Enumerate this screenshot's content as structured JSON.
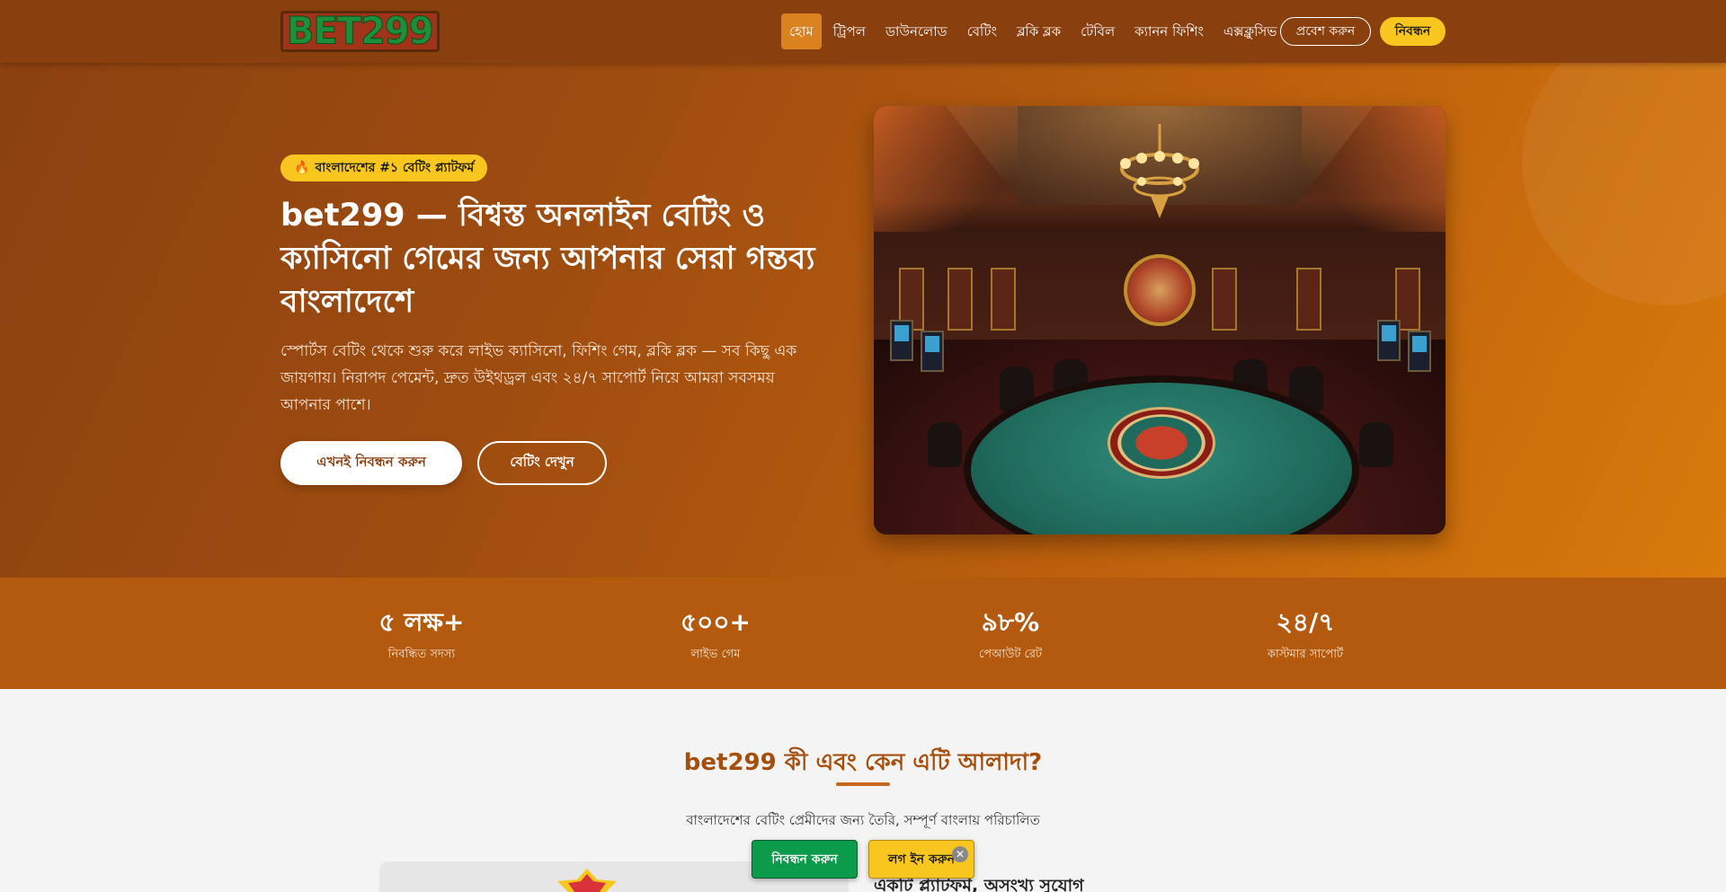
{
  "header": {
    "logo_text": "BET299",
    "nav": [
      {
        "label": "হোম",
        "active": true
      },
      {
        "label": "ট্রিপল"
      },
      {
        "label": "ডাউনলোড"
      },
      {
        "label": "বেটিং"
      },
      {
        "label": "ব্লকি ব্লক"
      },
      {
        "label": "টেবিল"
      },
      {
        "label": "ক্যানন ফিশিং"
      },
      {
        "label": "এক্সক্লুসিভ"
      }
    ],
    "login_label": "প্রবেশ করুন",
    "register_label": "নিবন্ধন"
  },
  "hero": {
    "badge_icon": "🔥",
    "badge_text": "বাংলাদেশের #১ বেটিং প্ল্যাটফর্ম",
    "title": "bet299 — বিশ্বস্ত অনলাইন বেটিং ও ক্যাসিনো গেমের জন্য আপনার সেরা গন্তব্য বাংলাদেশে",
    "description": "স্পোর্টস বেটিং থেকে শুরু করে লাইভ ক্যাসিনো, ফিশিং গেম, ব্লকি ব্লক — সব কিছু এক জায়গায়। নিরাপদ পেমেন্ট, দ্রুত উইথড্রল এবং ২৪/৭ সাপোর্ট নিয়ে আমরা সবসময় আপনার পাশে।",
    "primary_cta": "এখনই নিবন্ধন করুন",
    "secondary_cta": "বেটিং দেখুন"
  },
  "stats": [
    {
      "value": "৫ লক্ষ+",
      "label": "নিবন্ধিত সদস্য"
    },
    {
      "value": "৫০০+",
      "label": "লাইভ গেম"
    },
    {
      "value": "৯৮%",
      "label": "পেআউট রেট"
    },
    {
      "value": "২৪/৭",
      "label": "কাস্টমার সাপোর্ট"
    }
  ],
  "about": {
    "title": "bet299 কী এবং কেন এটি আলাদা?",
    "subtitle": "বাংলাদেশের বেটিং প্রেমীদের জন্য তৈরি, সম্পূর্ণ বাংলায় পরিচালিত",
    "card_heading": "একটি প্ল্যাটফর্ম, অসংখ্য সুযোগ"
  },
  "sticky": {
    "register_label": "নিবন্ধন করুন",
    "login_label": "লগ ইন করুন",
    "close_icon": "✕"
  },
  "colors": {
    "header_bg": "#8a3f0f",
    "accent_yellow": "#f8c61e",
    "accent_green": "#0c9b4a",
    "stats_bg": "#b45a0e",
    "heading_orange": "#a64e0b"
  }
}
